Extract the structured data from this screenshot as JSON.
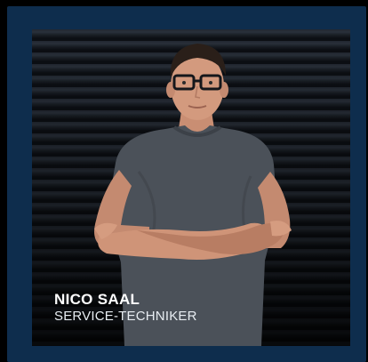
{
  "profile": {
    "name": "NICO SAAL",
    "role": "SERVICE-TECHNIKER"
  },
  "colors": {
    "frame": "#0e2d4d",
    "background": "#000000",
    "shirt": "#4b5159",
    "text": "#ffffff"
  }
}
